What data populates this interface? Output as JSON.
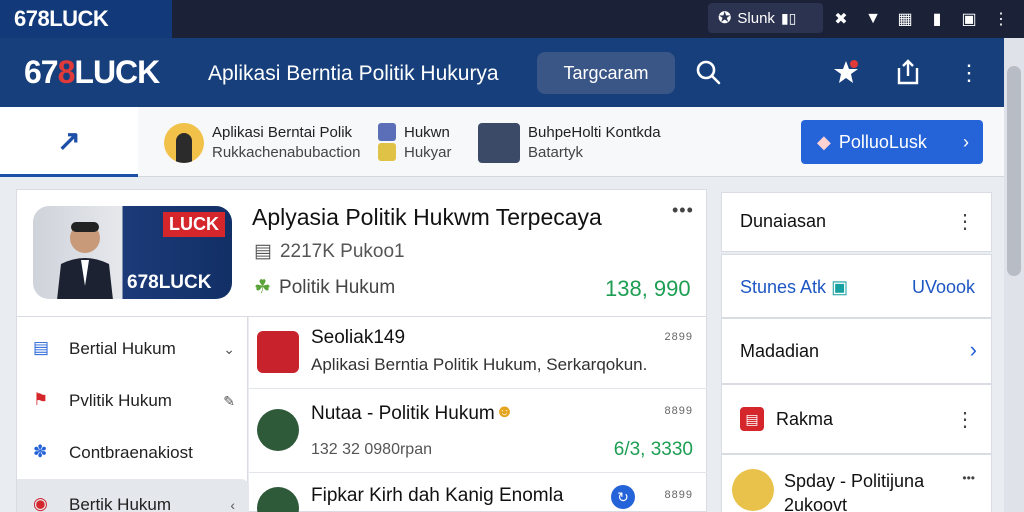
{
  "statusbar": {
    "app_label": "678LUCK",
    "pill_text": "Slunk",
    "icons": [
      "bluetooth-icon",
      "signal-icon",
      "wifi-icon",
      "battery-icon",
      "screen-icon",
      "more-icon"
    ]
  },
  "header": {
    "brand_prefix": "67",
    "brand_8": "8",
    "brand_suffix": "LUCK",
    "title": "Aplikasi Berntia Politik Hukurya",
    "button_label": "Targcaram",
    "icons": [
      "search-icon",
      "star-icon",
      "share-icon",
      "more-vertical-icon"
    ]
  },
  "tabs": {
    "home_glyph": "↗",
    "items": [
      {
        "title": "Aplikasi Berntai Polіk",
        "sub": "Rukkachenabubaction"
      },
      {
        "title": "Hukwn",
        "sub": "Hukyar"
      },
      {
        "title": "BuhpeHolti Kontkda",
        "sub": "Batartyk"
      }
    ],
    "cta_label": "PolluoLusk",
    "accent": "#2563d9"
  },
  "card": {
    "image_badge": "LUCK",
    "image_brand": "678LUCK",
    "title": "Aplyasia Politik Hukwm Terpecaya",
    "meta": "2217K Pukoo1",
    "category": "Politik Hukum",
    "number": "138, 990"
  },
  "nav": {
    "items": [
      {
        "label": "Bertial Hukum",
        "tail": "⌄"
      },
      {
        "label": "Pvlitik Hukum",
        "tail": "✎"
      },
      {
        "label": "Contbraenakiost",
        "tail": ""
      },
      {
        "label": "Bertik Hukum",
        "tail": "‹"
      }
    ]
  },
  "feed": {
    "items": [
      {
        "title": "Seoliak149",
        "sub": "Aplikasi Berntia Politik Hukum, Serkarqokun.",
        "time": "2899"
      },
      {
        "title": "Nutaa - Politik Hukum",
        "meta": "132 32 0980rpan",
        "time": "8899",
        "number": "6/3, 3330"
      },
      {
        "title": "Fipkar Kirh dah Kanig Enomla",
        "time": "8899"
      }
    ]
  },
  "right": {
    "box1": {
      "title": "Dunaiasan"
    },
    "box2": {
      "left": "Stunes Atk",
      "right": "UVoook"
    },
    "box3": {
      "title": "Madadian"
    },
    "box4": {
      "title": "Rakma"
    },
    "box5": {
      "title": "Spday - Politijuna",
      "sub": "2ukoovt"
    }
  }
}
